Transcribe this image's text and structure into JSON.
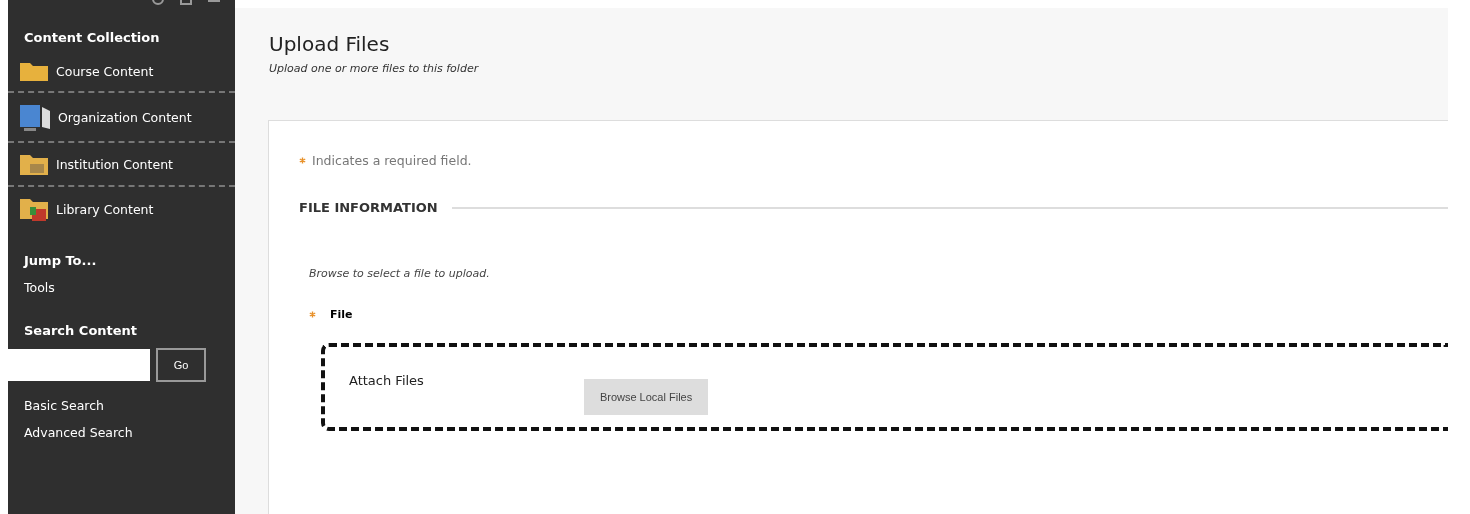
{
  "sidebar": {
    "sections": [
      {
        "title": "Content Collection",
        "items": [
          {
            "label": "Course Content",
            "kind": "folder"
          },
          {
            "label": "Organization Content",
            "kind": "computer"
          },
          {
            "label": "Institution Content",
            "kind": "building"
          },
          {
            "label": "Library Content",
            "kind": "library"
          }
        ]
      },
      {
        "title": "Jump To...",
        "items": [
          {
            "label": "Tools",
            "kind": "link"
          }
        ]
      },
      {
        "title": "Search Content"
      }
    ],
    "search": {
      "button": "Go"
    },
    "links": [
      "Basic Search",
      "Advanced Search"
    ]
  },
  "page": {
    "title": "Upload Files",
    "subtitle": "Upload one or more files to this folder"
  },
  "form": {
    "required_note": "Indicates a required field.",
    "section": "FILE INFORMATION",
    "instructions": "Browse to select a file to upload.",
    "field": {
      "label": "File",
      "required": true
    },
    "dropzone": {
      "label": "Attach Files",
      "button": "Browse Local Files"
    }
  }
}
